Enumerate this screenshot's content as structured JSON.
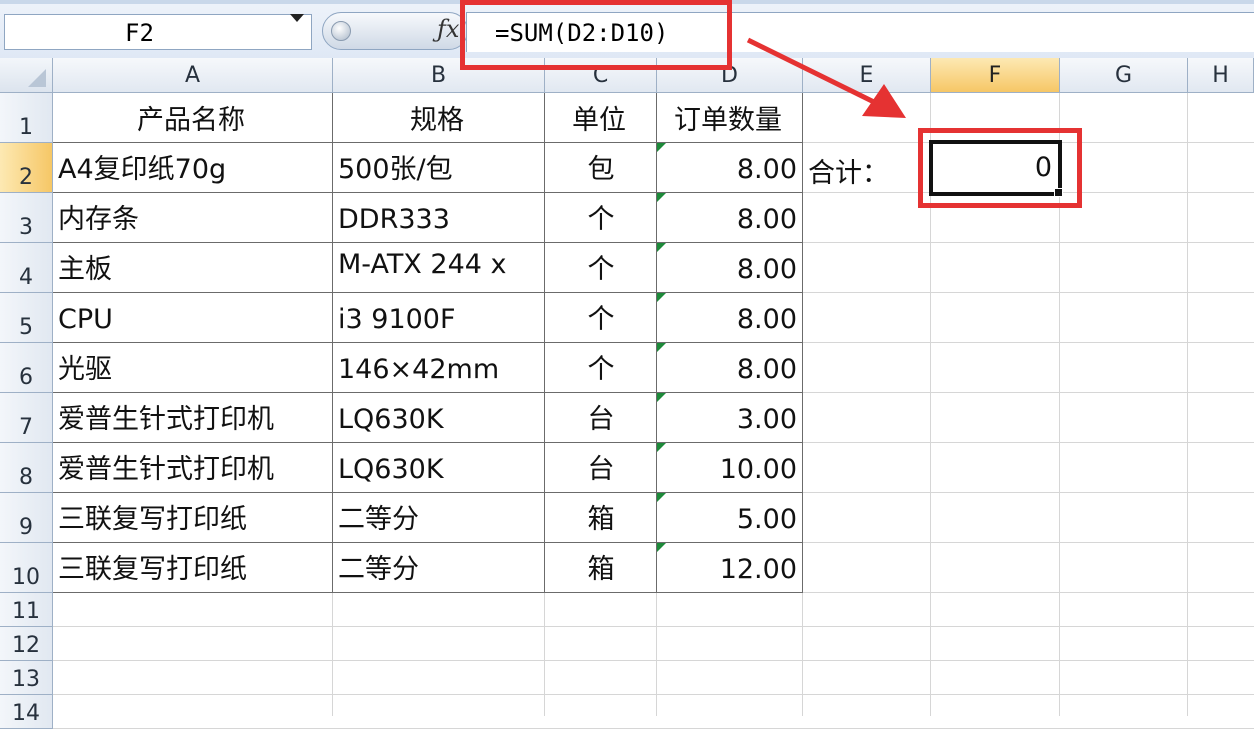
{
  "formula_bar": {
    "name_box": "F2",
    "fx_icon": "fx-icon",
    "formula": "=SUM(D2:D10)"
  },
  "columns": [
    "A",
    "B",
    "C",
    "D",
    "E",
    "F",
    "G",
    "H"
  ],
  "rows": [
    "1",
    "2",
    "3",
    "4",
    "5",
    "6",
    "7",
    "8",
    "9",
    "10",
    "11",
    "12",
    "13",
    "14"
  ],
  "header_row": {
    "A": "产品名称",
    "B": "规格",
    "C": "单位",
    "D": "订单数量"
  },
  "data_rows": [
    {
      "A": "A4复印纸70g",
      "B": "500张/包",
      "C": "包",
      "D": "8.00"
    },
    {
      "A": "内存条",
      "B": "DDR333",
      "C": "个",
      "D": "8.00"
    },
    {
      "A": "主板",
      "B": "M-ATX 244 x",
      "C": "个",
      "D": "8.00"
    },
    {
      "A": "CPU",
      "B": "i3 9100F",
      "C": "个",
      "D": "8.00"
    },
    {
      "A": "光驱",
      "B": "146×42mm",
      "C": "个",
      "D": "8.00"
    },
    {
      "A": "爱普生针式打印机",
      "B": "LQ630K",
      "C": "台",
      "D": "3.00"
    },
    {
      "A": "爱普生针式打印机",
      "B": "LQ630K",
      "C": "台",
      "D": "10.00"
    },
    {
      "A": "三联复写打印纸",
      "B": "二等分",
      "C": "箱",
      "D": "5.00"
    },
    {
      "A": "三联复写打印纸",
      "B": "二等分",
      "C": "箱",
      "D": "12.00"
    }
  ],
  "sum_label": "合计：",
  "active_cell_value": "0",
  "colors": {
    "annotation_red": "#e53232",
    "active_header": "#f6c766",
    "number_text_marker": "#1d8a3a"
  }
}
